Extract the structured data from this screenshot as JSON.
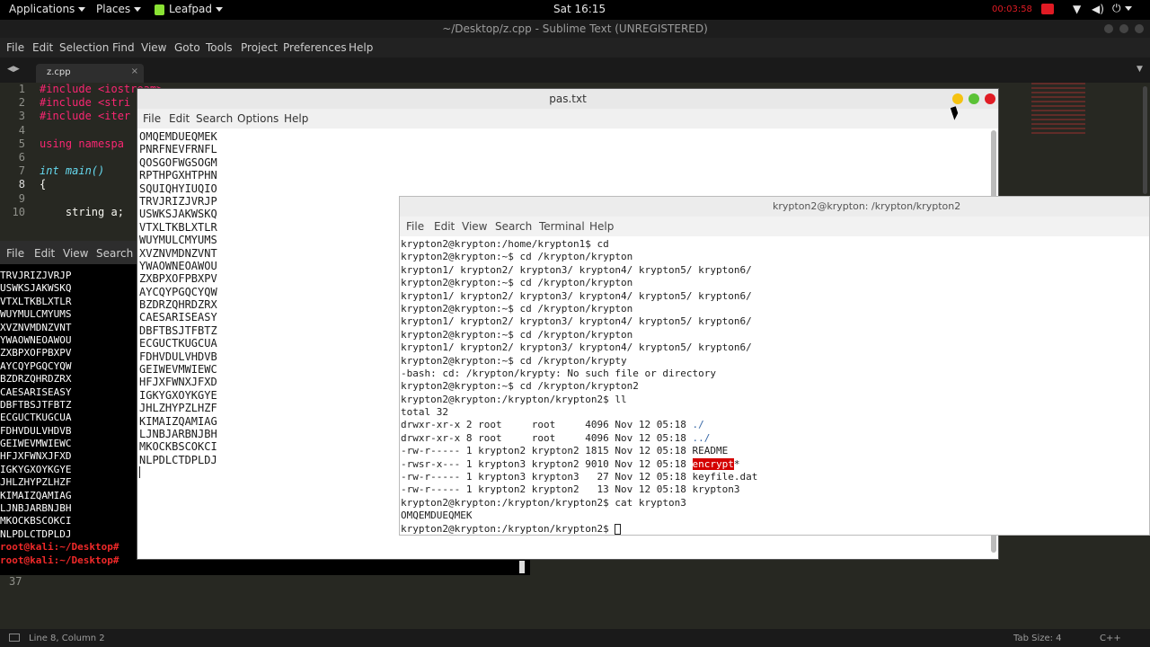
{
  "topbar": {
    "applications": "Applications",
    "places": "Places",
    "leafpad": "Leafpad",
    "clock": "Sat 16:15",
    "record_time": "00:03:58"
  },
  "sublime": {
    "title": "~/Desktop/z.cpp - Sublime Text (UNREGISTERED)",
    "menu": [
      "File",
      "Edit",
      "Selection",
      "Find",
      "View",
      "Goto",
      "Tools",
      "Project",
      "Preferences",
      "Help"
    ],
    "tab": "z.cpp",
    "gutter": [
      "1",
      "2",
      "3",
      "4",
      "5",
      "6",
      "7",
      "8",
      "9",
      "10"
    ],
    "gutter_extra": "37",
    "code": [
      "#include <iostream>",
      "#include <stri",
      "#include <iter",
      "",
      "using namespa",
      "",
      "int main()",
      "{",
      "",
      "    string a;"
    ],
    "status_left": "Line 8, Column 2",
    "status_tab": "Tab Size: 4",
    "status_lang": "C++"
  },
  "bg_terminal": {
    "menu": [
      "File",
      "Edit",
      "View",
      "Search"
    ],
    "lines": [
      "TRVJRIZJVRJP",
      "USWKSJAKWSKQ",
      "VTXLTKBLXTLR",
      "WUYMULCMYUMS",
      "XVZNVMDNZVNT",
      "YWAOWNEOAWOU",
      "ZXBPXOFPBXPV",
      "AYCQYPGQCYQW",
      "BZDRZQHRDZRX",
      "CAESARISEASY",
      "DBFTBSJTFBTZ",
      "ECGUCTKUGCUA",
      "FDHVDULVHDVB",
      "GEIWEVMWIEWC",
      "HFJXFWNXJFXD",
      "IGKYGXOYKGYE",
      "JHLZHYPZLHZF",
      "KIMAIZQAMIAG",
      "LJNBJARBNJBH",
      "MKOCKBSCOKCI",
      "NLPDLCTDPLDJ",
      "root@kali:~/Desktop#",
      "root@kali:~/Desktop#"
    ]
  },
  "leafpad": {
    "title": "pas.txt",
    "menu": [
      "File",
      "Edit",
      "Search",
      "Options",
      "Help"
    ],
    "lines": [
      "OMQEMDUEQMEK",
      "PNRFNEVFRNFL",
      "QOSGOFWGSOGM",
      "RPTHPGXHTPHN",
      "SQUIQHYIUQIO",
      "TRVJRIZJVRJP",
      "USWKSJAKWSKQ",
      "VTXLTKBLXTLR",
      "WUYMULCMYUMS",
      "XVZNVMDNZVNT",
      "YWAOWNEOAWOU",
      "ZXBPXOFPBXPV",
      "AYCQYPGQCYQW",
      "BZDRZQHRDZRX",
      "CAESARISEASY",
      "DBFTBSJTFBTZ",
      "ECGUCTKUGCUA",
      "FDHVDULVHDVB",
      "GEIWEVMWIEWC",
      "HFJXFWNXJFXD",
      "IGKYGXOYKGYE",
      "JHLZHYPZLHZF",
      "KIMAIZQAMIAG",
      "LJNBJARBNJBH",
      "MKOCKBSCOKCI",
      "NLPDLCTDPLDJ"
    ]
  },
  "terminal": {
    "title": "krypton2@krypton: /krypton/krypton2",
    "menu": [
      "File",
      "Edit",
      "View",
      "Search",
      "Terminal",
      "Help"
    ],
    "lines": [
      "krypton2@krypton:/home/krypton1$ cd",
      "krypton2@krypton:~$ cd /krypton/krypton",
      "krypton1/ krypton2/ krypton3/ krypton4/ krypton5/ krypton6/",
      "krypton2@krypton:~$ cd /krypton/krypton",
      "krypton1/ krypton2/ krypton3/ krypton4/ krypton5/ krypton6/",
      "krypton2@krypton:~$ cd /krypton/krypton",
      "krypton1/ krypton2/ krypton3/ krypton4/ krypton5/ krypton6/",
      "krypton2@krypton:~$ cd /krypton/krypton",
      "krypton1/ krypton2/ krypton3/ krypton4/ krypton5/ krypton6/",
      "krypton2@krypton:~$ cd /krypton/krypty",
      "-bash: cd: /krypton/krypty: No such file or directory",
      "krypton2@krypton:~$ cd /krypton/krypton2",
      "krypton2@krypton:/krypton/krypton2$ ll",
      "total 32"
    ],
    "ls_rows": [
      {
        "pre": "drwxr-xr-x 2 root     root     4096 Nov 12 05:18 ",
        "name": "./",
        "cls": "dir"
      },
      {
        "pre": "drwxr-xr-x 8 root     root     4096 Nov 12 05:18 ",
        "name": "../",
        "cls": "dir"
      },
      {
        "pre": "-rw-r----- 1 krypton2 krypton2 1815 Nov 12 05:18 ",
        "name": "README",
        "cls": ""
      },
      {
        "pre": "-rwsr-x--- 1 krypton3 krypton2 9010 Nov 12 05:18 ",
        "name": "encrypt",
        "cls": "hl",
        "suffix": "*"
      },
      {
        "pre": "-rw-r----- 1 krypton3 krypton3   27 Nov 12 05:18 ",
        "name": "keyfile.dat",
        "cls": ""
      },
      {
        "pre": "-rw-r----- 1 krypton2 krypton2   13 Nov 12 05:18 ",
        "name": "krypton3",
        "cls": ""
      }
    ],
    "after": [
      "krypton2@krypton:/krypton/krypton2$ cat krypton3",
      "OMQEMDUEQMEK"
    ],
    "prompt": "krypton2@krypton:/krypton/krypton2$ "
  }
}
